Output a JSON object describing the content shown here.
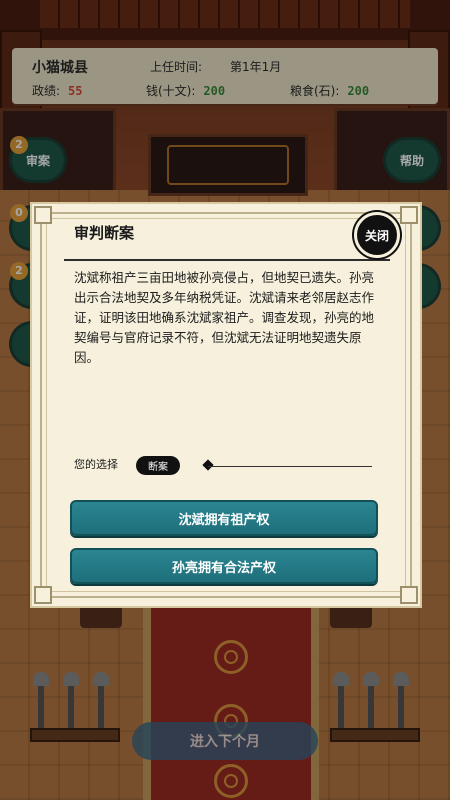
{
  "header": {
    "county": "小猫城县",
    "time_label": "上任时间:",
    "time_value": "第1年1月",
    "stats": [
      {
        "label": "政绩:",
        "value": "55",
        "color": "#d94a38"
      },
      {
        "label": "钱(十文):",
        "value": "200",
        "color": "#3b8a3a"
      },
      {
        "label": "粮食(石):",
        "value": "200",
        "color": "#3b8a3a"
      }
    ]
  },
  "side_buttons": {
    "left": [
      {
        "label": "审案",
        "badge": "2"
      },
      {
        "label": "",
        "badge": "0"
      },
      {
        "label": "",
        "badge": "2"
      },
      {
        "label": "",
        "badge": ""
      }
    ],
    "right": [
      {
        "label": "帮助"
      },
      {
        "label": ""
      },
      {
        "label": ""
      }
    ]
  },
  "modal": {
    "title": "审判断案",
    "close_label": "关闭",
    "story": "沈斌称祖产三亩田地被孙亮侵占，但地契已遗失。孙亮出示合法地契及多年纳税凭证。沈斌请来老邻居赵志作证，证明该田地确系沈斌家祖产。调查发现，孙亮的地契编号与官府记录不符，但沈斌无法证明地契遗失原因。",
    "choice_label": "您的选择",
    "choice_tag": "断案",
    "options": [
      "沈斌拥有祖产权",
      "孙亮拥有合法产权"
    ]
  },
  "footer": {
    "next_label": "进入下个月"
  },
  "colors": {
    "option_bg": "#1f6f7b",
    "modal_bg": "#f6f0dc",
    "side_button_bg": "#1f5a4b"
  }
}
